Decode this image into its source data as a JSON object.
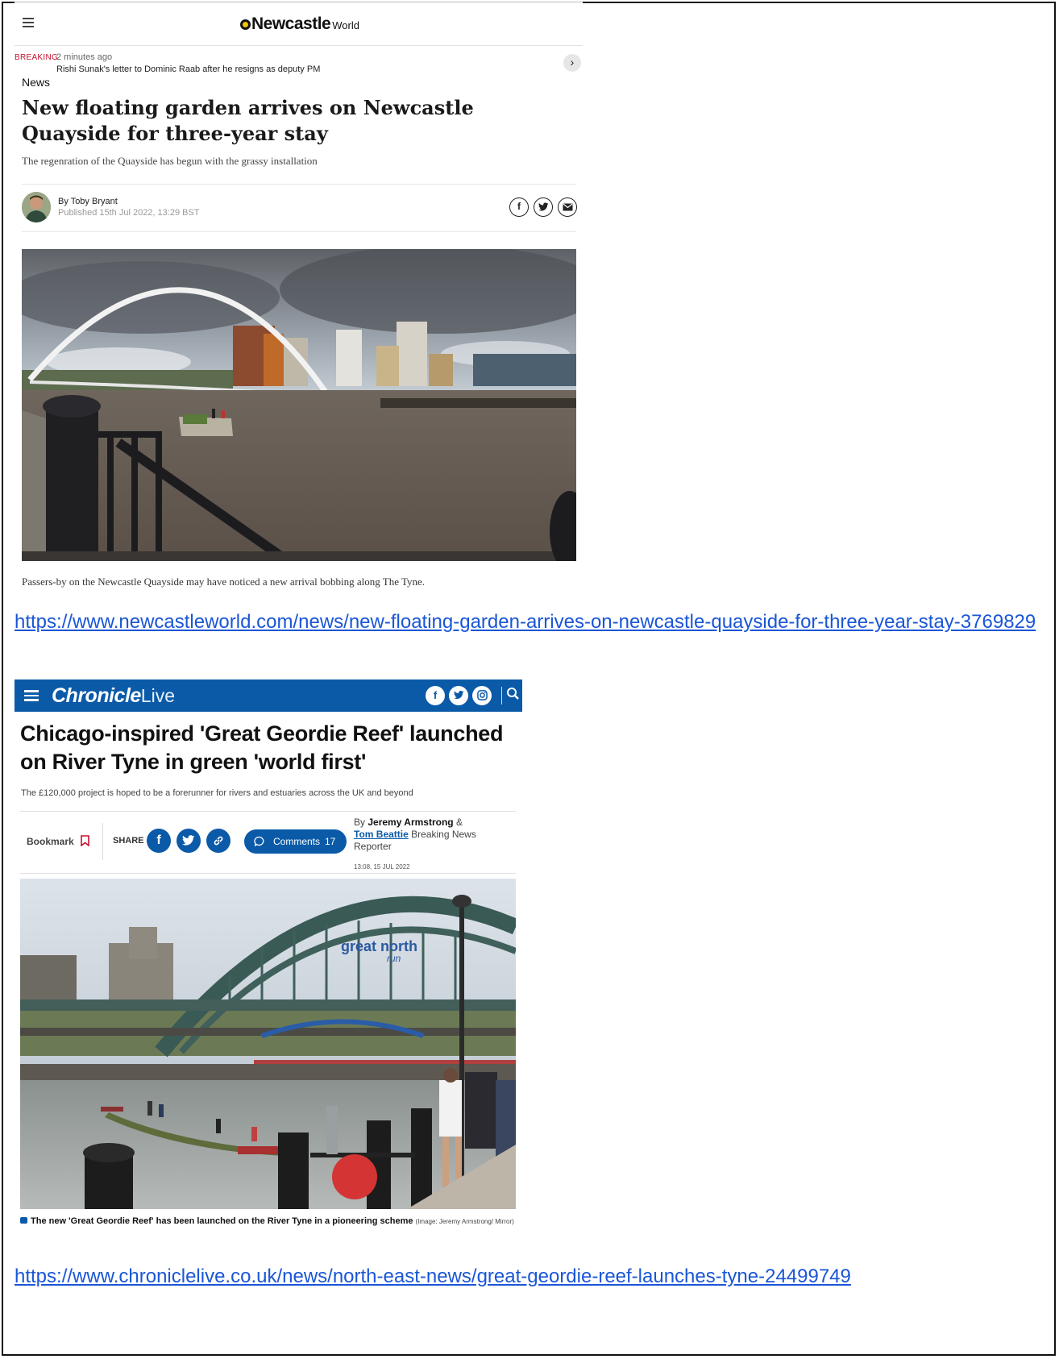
{
  "newcastle_world": {
    "logo_main": "Newcastle",
    "logo_sub": "World",
    "breaking": {
      "tag": "BREAKING",
      "time": "2 minutes ago",
      "headline": "Rishi Sunak's letter to Dominic Raab after he resigns as deputy PM"
    },
    "section": "News",
    "title": "New floating garden arrives on Newcastle Quayside for three-year stay",
    "subtitle": "The regenration of the Quayside has begun with the grassy installation",
    "author": "By Toby Bryant",
    "published": "Published 15th Jul 2022, 13:29 BST",
    "share_icons": [
      "facebook-icon",
      "twitter-icon",
      "email-icon"
    ],
    "caption": "Passers-by on the Newcastle Quayside may have noticed a new arrival bobbing along The Tyne."
  },
  "link_1": "https://www.newcastleworld.com/news/new-floating-garden-arrives-on-newcastle-quayside-for-three-year-stay-3769829",
  "chronicle_live": {
    "logo_bold": "Chronicle",
    "logo_light": "Live",
    "title": "Chicago-inspired 'Great Geordie Reef' launched on River Tyne in green 'world first'",
    "standfirst": "The £120,000 project is hoped to be a forerunner for rivers and estuaries across the UK and beyond",
    "bookmark_label": "Bookmark",
    "share_label": "SHARE",
    "comments_label": "Comments",
    "comments_count": "17",
    "byline_prefix": "By",
    "author_1": "Jeremy Armstrong",
    "amp": "&",
    "author_2": "Tom Beattie",
    "author_2_role": "Breaking News Reporter",
    "timestamp": "13:08, 15 JUL 2022",
    "photo_overlay": "great north",
    "photo_overlay_sub": "run",
    "caption": "The new 'Great Geordie Reef' has been launched on the River Tyne in a pioneering scheme",
    "caption_credit": "(Image: Jeremy Armstrong/ Mirror)"
  },
  "link_2": "https://www.chroniclelive.co.uk/news/north-east-news/great-geordie-reef-launches-tyne-24499749",
  "colors": {
    "breaking_red": "#c8102e",
    "chronicle_blue": "#0a5aa8",
    "link_blue": "#1a56d6",
    "newcastle_yellow": "#f5c400"
  }
}
